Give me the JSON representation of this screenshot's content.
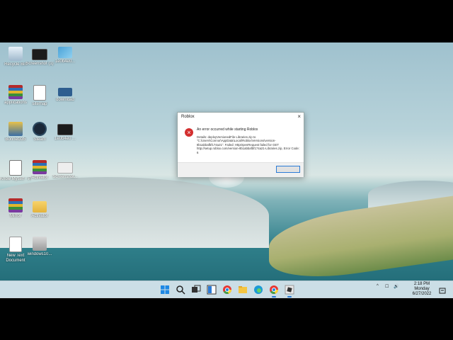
{
  "desktop": {
    "icons": [
      {
        "label": "Recycle Bin",
        "icon": "recycle-bin-icon"
      },
      {
        "label": "Screenshot (1)",
        "icon": "screenshot-icon"
      },
      {
        "label": "1e0b4e0...",
        "icon": "image-file-icon"
      },
      {
        "label": "applications",
        "icon": "winrar-icon"
      },
      {
        "label": "sitemap",
        "icon": "document-icon"
      },
      {
        "label": "download",
        "icon": "image-file-icon"
      },
      {
        "label": "Bonnet335",
        "icon": "app-icon"
      },
      {
        "label": "Steam",
        "icon": "steam-icon"
      },
      {
        "label": "1e0b4e0 ...",
        "icon": "screenshot-icon"
      },
      {
        "label": "Know Myself - Patrick Pa...",
        "icon": "mp3-file-icon"
      },
      {
        "label": "Activator",
        "icon": "winrar-icon"
      },
      {
        "label": "Screenshot...",
        "icon": "screenshot-icon"
      },
      {
        "label": "Mirror",
        "icon": "winrar-icon"
      },
      {
        "label": "Activator",
        "icon": "folder-icon"
      },
      {
        "label": "New Text Document",
        "icon": "text-document-icon"
      },
      {
        "label": "windows10...",
        "icon": "windows-installer-icon"
      }
    ]
  },
  "dialog": {
    "title": "Roblox",
    "close_glyph": "×",
    "heading": "An error occurred while starting Roblox",
    "details": "Details: deployVersionedFile Libraries.zip to \"C:\\Users\\Connor\\AppData\\Local\\Roblox\\Versions\\version-8b1abbafbf174a21\". Failed: HttpOpenRequest failed for GET http://setup.roblox.com/version-8b1abbafbf174a21-Libraries.zip, Error Code: 6",
    "ok_label": ""
  },
  "taskbar": {
    "apps": [
      "windows-start-icon",
      "search-icon",
      "task-view-icon",
      "widgets-icon",
      "chrome-icon",
      "file-explorer-icon",
      "edge-icon",
      "chrome-icon",
      "roblox-icon"
    ],
    "tray": {
      "chevron": "^",
      "network": "☐",
      "volume": "🔊"
    },
    "clock": {
      "time": "2:18 PM",
      "day": "Monday",
      "date": "6/27/2022"
    }
  },
  "colors": {
    "accent": "#2b7bd6",
    "error": "#d32f2f",
    "taskbar": "#dae8f0"
  }
}
